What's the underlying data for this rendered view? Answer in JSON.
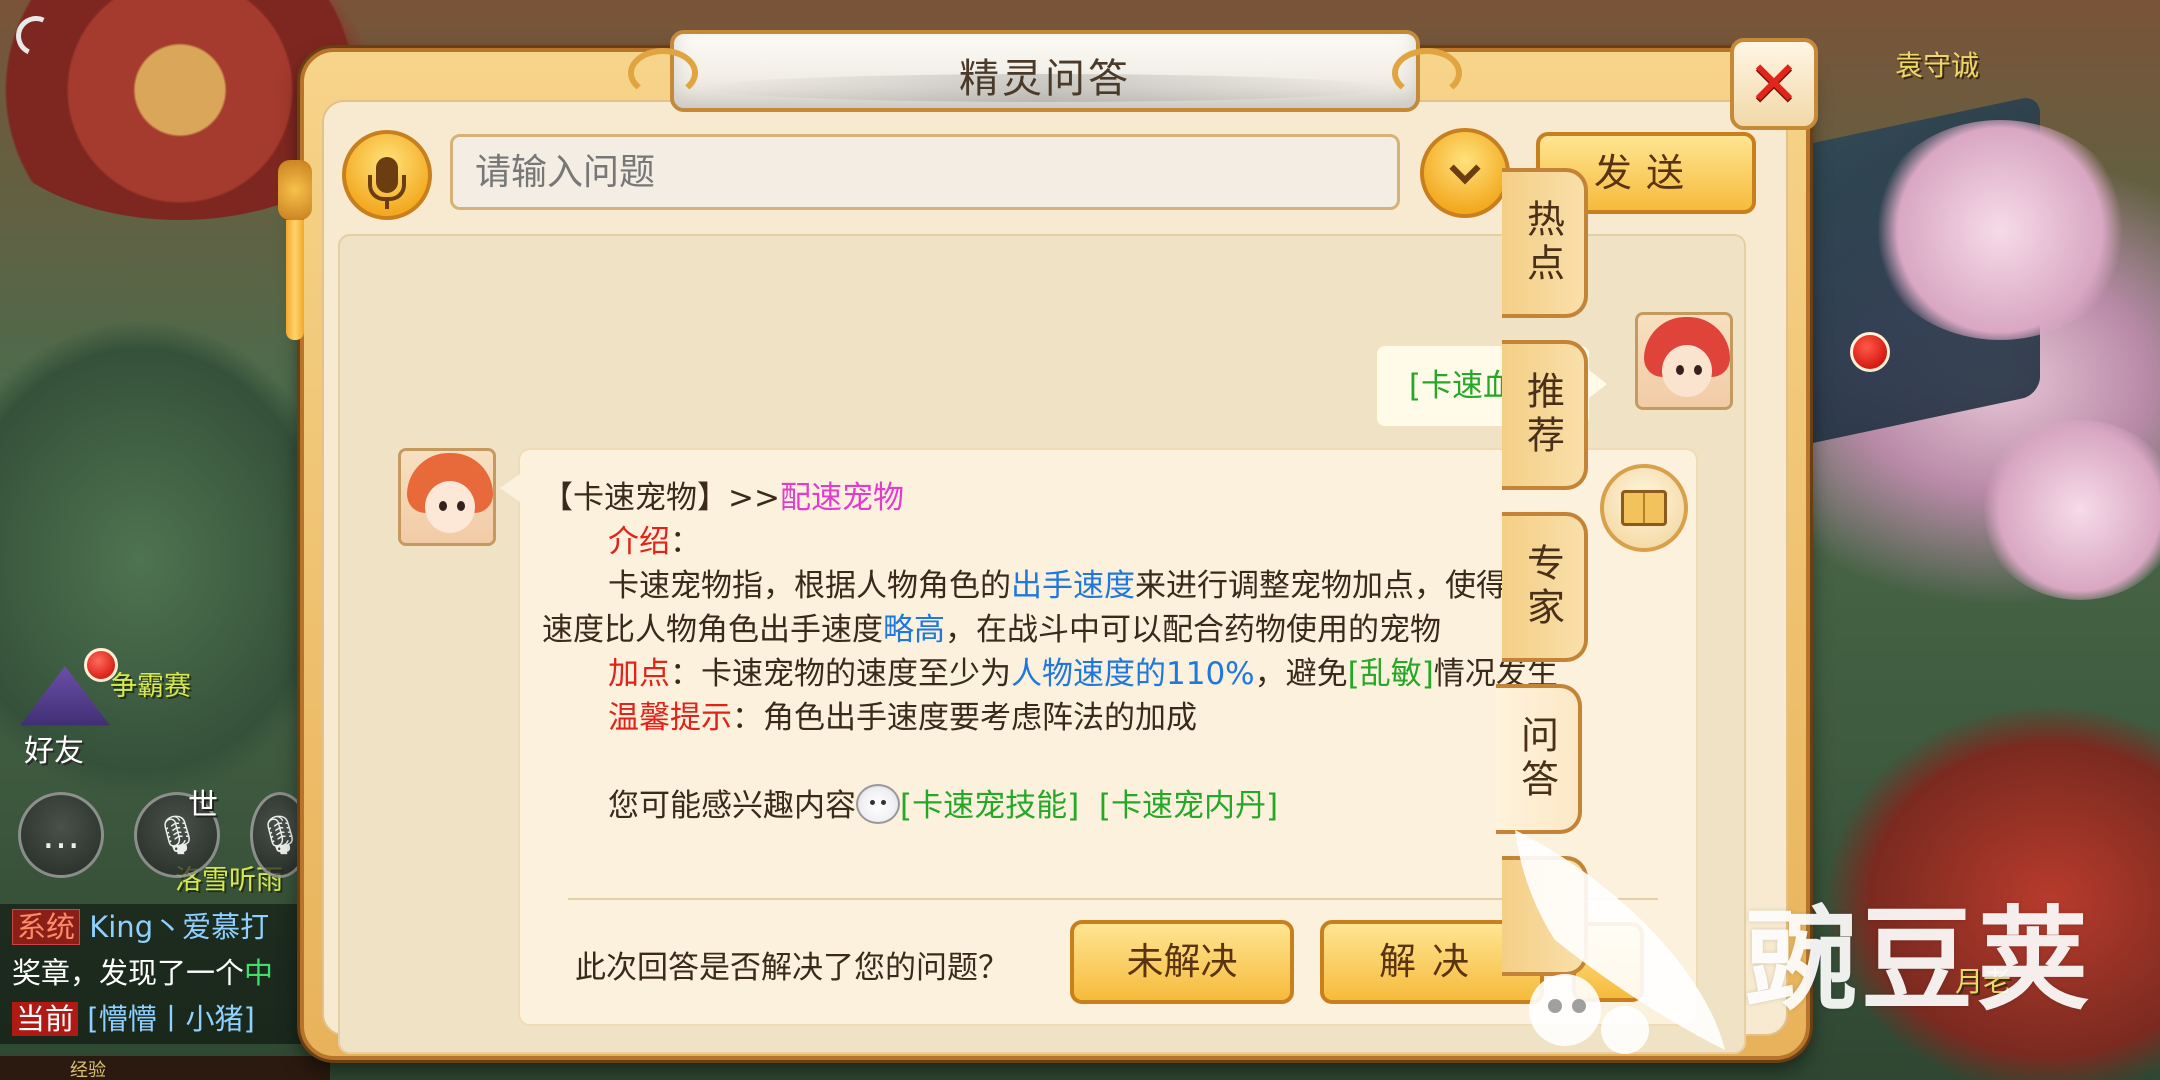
{
  "scene": {
    "place_name": "袁守诚",
    "npc_name": "月老",
    "player_names": [
      "争霸赛",
      "洛雪听雨"
    ]
  },
  "hud": {
    "friends_label": "好友",
    "world_label": "世",
    "chat_lines": [
      {
        "tag": "系统",
        "text": "King丶爱慕打"
      },
      {
        "text": "奖章，发现了一个",
        "highlight": "中"
      },
      {
        "tag": "当前",
        "text": "[懵懵丨小猪]"
      }
    ],
    "bottom_text": "经验"
  },
  "dialog": {
    "title": "精灵问答",
    "close_label": "✕",
    "toolbar": {
      "input_placeholder": "请输入问题",
      "input_value": "",
      "send_label": "发送"
    },
    "side_tabs": [
      {
        "label": "热点",
        "active": false
      },
      {
        "label": "推荐",
        "active": false,
        "badge": true
      },
      {
        "label": "专家",
        "active": false
      },
      {
        "label": "问答",
        "active": true
      }
    ],
    "user_message": "[卡速血宠]",
    "bot_message": {
      "title_prefix": "【卡速宠物】>>",
      "title_link": "配速宠物",
      "intro_label": "介绍",
      "intro_colon": "：",
      "intro_text_1": "卡速宠物指，根据人物角色的",
      "intro_link_1": "出手速度",
      "intro_text_2": "来进行调整宠物加点，使得宠物",
      "intro_text_3": "速度比人物角色出手速度",
      "intro_link_2": "略高",
      "intro_text_4": "，在战斗中可以配合药物使用的宠物",
      "points_label": "加点",
      "points_colon": "：",
      "points_text_1": "卡速宠物的速度至少为",
      "points_link": "人物速度的110%",
      "points_text_2": "，避免",
      "points_link_2": "[乱敏]",
      "points_text_3": "情况发生",
      "tip_label": "温馨提示",
      "tip_colon": "：",
      "tip_text": "角色出手速度要考虑阵法的加成",
      "related_label": "您可能感兴趣内容",
      "related_links": [
        "[卡速宠技能]",
        "[卡速宠内丹]"
      ]
    },
    "feedback": {
      "question": "此次回答是否解决了您的问题？",
      "unsolved_label": "未解决",
      "solved_label": "解决"
    }
  },
  "watermark": {
    "text": "豌豆荚"
  },
  "colors": {
    "frame": "#e8b25a",
    "panel": "#f8ead0",
    "green_link": "#25a828",
    "blue_link": "#1f78e0",
    "red_label": "#e2231a",
    "magenta_link": "#e43ad0",
    "button_gold": "#f6bb3c"
  }
}
